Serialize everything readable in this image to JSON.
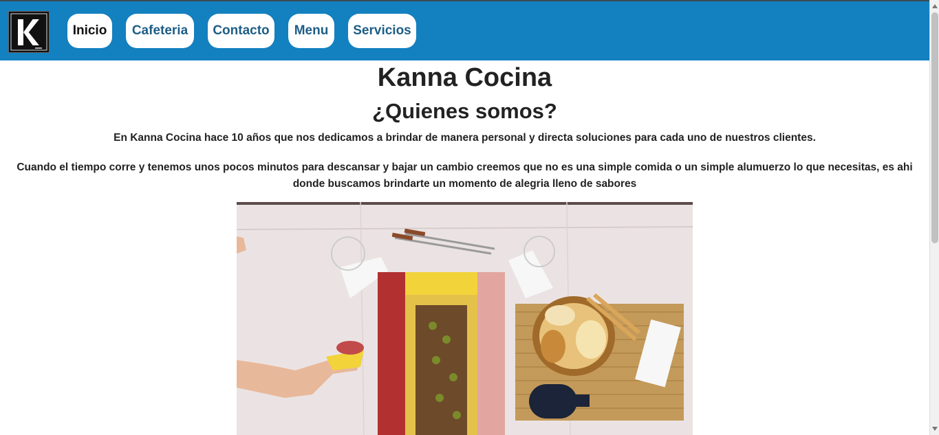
{
  "nav": {
    "logo_icon": "kanna-k-logo-icon",
    "items": [
      {
        "label": "Inicio",
        "active": true
      },
      {
        "label": "Cafeteria",
        "active": false
      },
      {
        "label": "Contacto",
        "active": false
      },
      {
        "label": "Menu",
        "active": false
      },
      {
        "label": "Servicios",
        "active": false
      }
    ],
    "bg_color": "#1380c0"
  },
  "main": {
    "title": "Kanna Cocina",
    "subtitle": "¿Quienes somos?",
    "paragraph1": "En Kanna Cocina hace 10 años que nos dedicamos a brindar de manera personal y directa soluciones para cada uno de nuestros clientes.",
    "paragraph2": "Cuando el tiempo corre y tenemos unos pocos minutos para descansar y bajar un cambio creemos que no es una simple comida o un simple alumuerzo lo que necesitas, es ahi donde buscamos brindarte un momento de alegria lleno de sabores",
    "hero_image": "picada-platter-photo"
  }
}
